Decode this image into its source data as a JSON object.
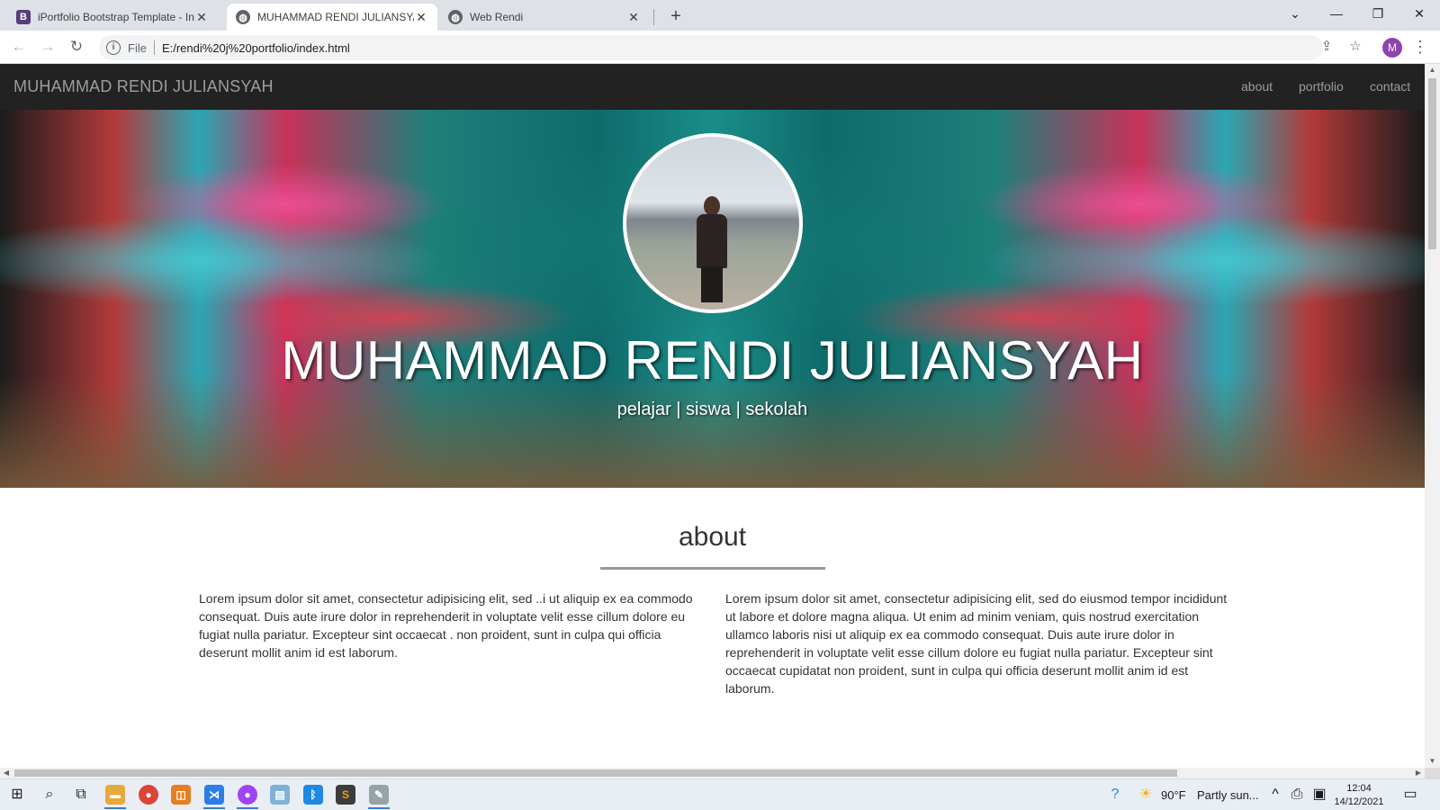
{
  "browser": {
    "tabs": [
      {
        "title": "iPortfolio Bootstrap Template - In",
        "favicon": "bootstrap-icon"
      },
      {
        "title": "MUHAMMAD RENDI JULIANSYAH",
        "favicon": "globe-icon"
      },
      {
        "title": "Web Rendi",
        "favicon": "globe-icon"
      }
    ],
    "address": {
      "scheme": "File",
      "url": "E:/rendi%20j%20portfolio/index.html"
    },
    "profile_initial": "M"
  },
  "page": {
    "brand": "MUHAMMAD RENDI JULIANSYAH",
    "nav": [
      "about",
      "portfolio",
      "contact"
    ],
    "hero": {
      "title": "MUHAMMAD RENDI JULIANSYAH",
      "subtitle": "pelajar | siswa | sekolah"
    },
    "about": {
      "heading": "about",
      "left": "Lorem ipsum dolor sit amet, consectetur adipisicing elit, sed ..i ut aliquip ex ea commodo consequat. Duis aute irure dolor in reprehenderit in voluptate velit esse cillum dolore eu fugiat nulla pariatur. Excepteur sint occaecat . non proident, sunt in culpa qui officia deserunt mollit anim id est laborum.",
      "right": "Lorem ipsum dolor sit amet, consectetur adipisicing elit, sed do eiusmod tempor incididunt ut labore et dolore magna aliqua. Ut enim ad minim veniam, quis nostrud exercitation ullamco laboris nisi ut aliquip ex ea commodo consequat. Duis aute irure dolor in reprehenderit in voluptate velit esse cillum dolore eu fugiat nulla pariatur. Excepteur sint occaecat cupidatat non proident, sunt in culpa qui officia deserunt mollit anim id est laborum."
    }
  },
  "taskbar": {
    "weather_temp": "90°F",
    "weather_text": "Partly sun...",
    "time": "12:04",
    "date": "14/12/2021"
  },
  "colors": {
    "navbar_bg": "#222222",
    "navbar_text": "#9d9d9d",
    "accent_line": "#999999"
  }
}
